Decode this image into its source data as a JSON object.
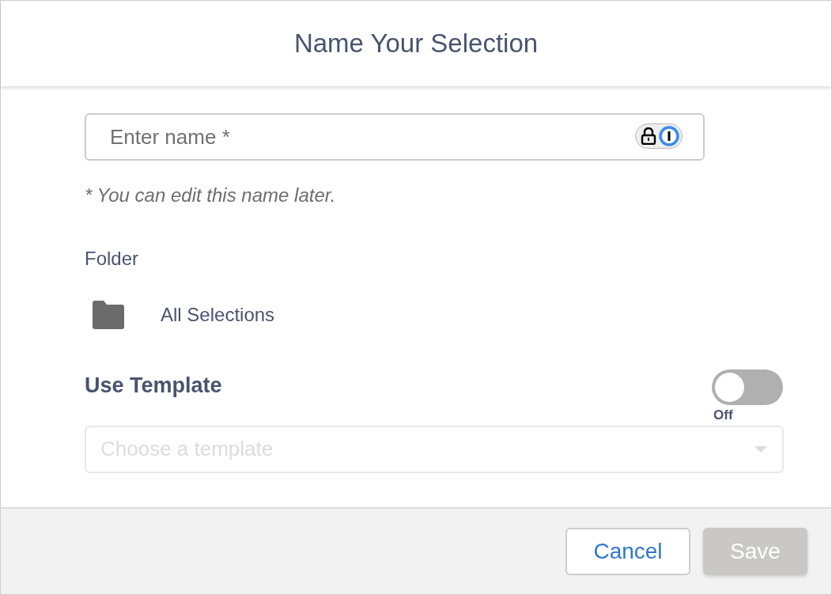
{
  "dialog": {
    "title": "Name Your Selection"
  },
  "name_field": {
    "placeholder": "Enter name *"
  },
  "hint": "* You can edit this name later.",
  "folder": {
    "label": "Folder",
    "value": "All Selections"
  },
  "template": {
    "label": "Use Template",
    "on": false,
    "state_label": "Off",
    "placeholder": "Choose a template",
    "disabled": true
  },
  "buttons": [
    {
      "label": "Cancel",
      "kind": "secondary",
      "disabled": false
    },
    {
      "label": "Save",
      "kind": "primary",
      "disabled": true
    }
  ]
}
